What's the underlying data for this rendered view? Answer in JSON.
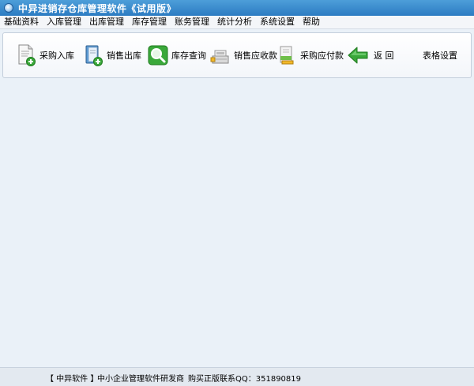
{
  "window": {
    "title": "中异进销存仓库管理软件《试用版》"
  },
  "menu": [
    {
      "label": "基础资料"
    },
    {
      "label": "入库管理"
    },
    {
      "label": "出库管理"
    },
    {
      "label": "库存管理"
    },
    {
      "label": "账务管理"
    },
    {
      "label": "统计分析"
    },
    {
      "label": "系统设置"
    },
    {
      "label": "帮助"
    }
  ],
  "toolbar": [
    {
      "label": "采购入库",
      "icon": "document-add-icon"
    },
    {
      "label": "销售出库",
      "icon": "book-add-icon"
    },
    {
      "label": "库存查询",
      "icon": "magnifier-icon"
    },
    {
      "label": "销售应收款",
      "icon": "cash-register-icon"
    },
    {
      "label": "采购应付款",
      "icon": "ledger-icon"
    },
    {
      "label": "返 回",
      "icon": "green-back-arrow-icon"
    },
    {
      "label": "表格设置",
      "icon": ""
    }
  ],
  "status": {
    "company": "【 中异软件 】",
    "slogan": "中小企业管理软件研发商",
    "contact": "购买正版联系QQ：351890819"
  },
  "colors": {
    "titlebar": "#2c7cc2",
    "workspace": "#eaf1f8",
    "accent_green": "#3aa83a"
  }
}
